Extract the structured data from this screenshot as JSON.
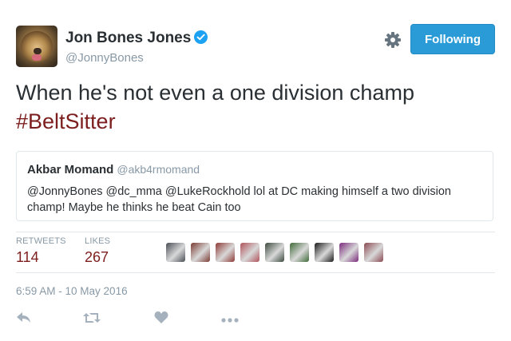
{
  "user": {
    "name": "Jon Bones Jones",
    "handle": "@JonnyBones",
    "verified": true
  },
  "follow_button": {
    "label": "Following",
    "color": "#2b9bd8"
  },
  "tweet": {
    "text": "When he's not even a one division champ",
    "hashtag": "#BeltSitter",
    "hashtag_color": "#7d1e1e"
  },
  "quoted_tweet": {
    "name": "Akbar Momand",
    "handle": "@akb4rmomand",
    "text": "@JonnyBones @dc_mma @LukeRockhold lol at DC making himself a two division champ! Maybe he thinks he beat Cain too"
  },
  "stats": {
    "retweets_label": "RETWEETS",
    "retweets_value": "114",
    "likes_label": "LIKES",
    "likes_value": "267"
  },
  "likers": [
    {
      "name": "liker-avatar-1",
      "color": "#4a4f55"
    },
    {
      "name": "liker-avatar-2",
      "color": "#7b3b32"
    },
    {
      "name": "liker-avatar-3",
      "color": "#8e3a36"
    },
    {
      "name": "liker-avatar-4",
      "color": "#b0525a"
    },
    {
      "name": "liker-avatar-5",
      "color": "#3c4a3f"
    },
    {
      "name": "liker-avatar-6",
      "color": "#3f6a38"
    },
    {
      "name": "liker-avatar-7",
      "color": "#1b1b1b"
    },
    {
      "name": "liker-avatar-8",
      "color": "#7a2a7c"
    },
    {
      "name": "liker-avatar-9",
      "color": "#8b4a52"
    }
  ],
  "timestamp": "6:59 AM - 10 May 2016",
  "actions": [
    "reply-icon",
    "retweet-icon",
    "like-icon",
    "more-icon"
  ]
}
